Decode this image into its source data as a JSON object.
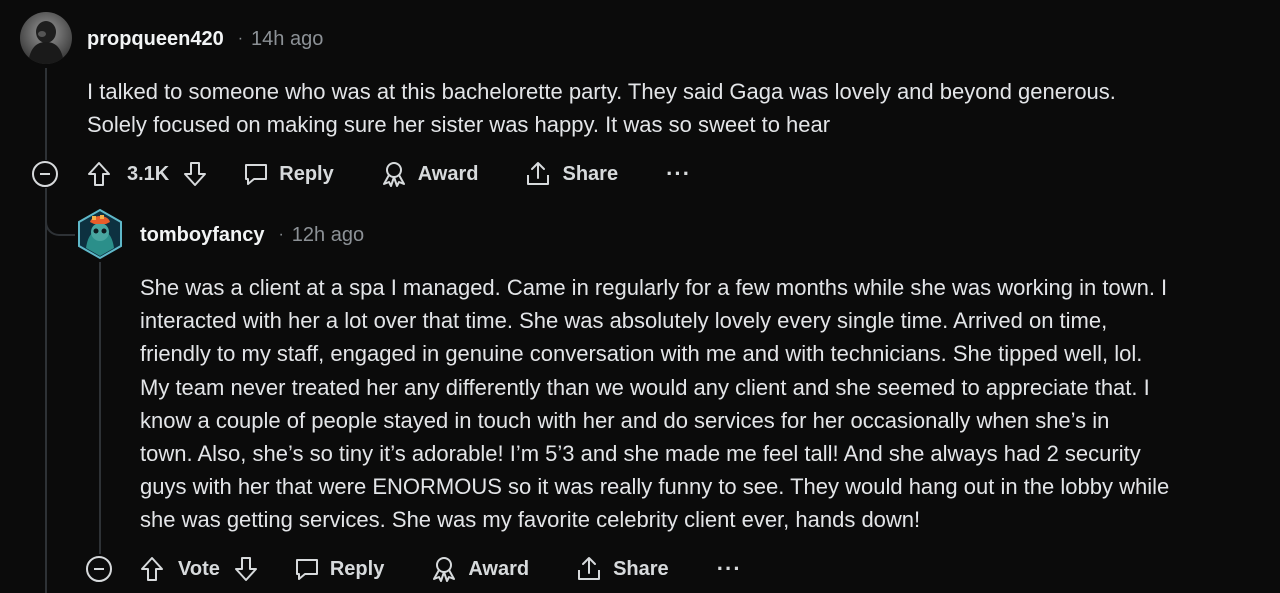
{
  "comment1": {
    "username": "propqueen420",
    "separator": "·",
    "time": "14h ago",
    "text_lines": [
      "I talked to someone who was at this bachelorette party. They said Gaga was lovely and beyond generous.",
      "Solely focused on making sure her sister was happy. It was so sweet to hear"
    ],
    "vote_count": "3.1K",
    "reply_label": "Reply",
    "award_label": "Award",
    "share_label": "Share",
    "more_label": "···"
  },
  "comment2": {
    "username": "tomboyfancy",
    "separator": "·",
    "time": "12h ago",
    "text_lines": [
      "She was a client at a spa I managed. Came in regularly for a few months while she was working in town. I",
      "interacted with her a lot over that time. She was absolutely lovely every single time. Arrived on time,",
      "friendly to my staff, engaged in genuine conversation with me and with technicians. She tipped well, lol.",
      "My team never treated her any differently than we would any client and she seemed to appreciate that. I",
      "know a couple of people stayed in touch with her and do services for her occasionally when she’s in",
      "town. Also, she’s so tiny it’s adorable! I’m 5’3 and she made me feel tall! And she always had 2 security",
      "guys with her that were ENORMOUS so it was really funny to see. They would hang out in the lobby while",
      "she was getting services. She was my favorite celebrity client ever, hands down!"
    ],
    "vote_label": "Vote",
    "reply_label": "Reply",
    "award_label": "Award",
    "share_label": "Share",
    "more_label": "···"
  },
  "icons": {
    "upvote": "arrow-up-icon",
    "downvote": "arrow-down-icon",
    "reply": "speech-bubble-icon",
    "award": "award-ribbon-icon",
    "share": "share-icon",
    "collapse": "collapse-minus-icon"
  },
  "colors": {
    "background": "#0b0b0b",
    "text": "#e3e5e8",
    "muted": "#8c9196",
    "thread": "#2e3236"
  }
}
